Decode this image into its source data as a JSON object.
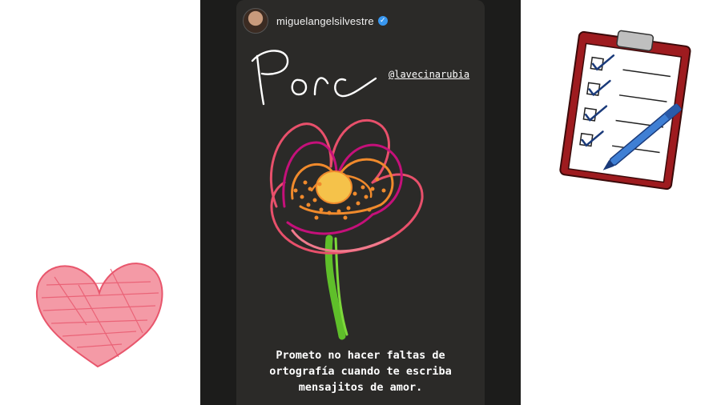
{
  "story": {
    "username": "miguelangelsilvestre",
    "verified_icon": "verified-badge-icon",
    "handwritten_word": "Porc",
    "mention": "@lavecinarubia",
    "caption_lines": [
      "Prometo no hacer faltas de",
      "ortografía cuando te escriba",
      "mensajitos de amor."
    ],
    "drawing": "flower-drawing",
    "colors": {
      "petal_outer": "#e8506b",
      "petal_inner": "#c5107a",
      "petal_orange": "#f08a2c",
      "center": "#f5c24a",
      "stem": "#5fbf2a",
      "background": "#2b2a28"
    }
  },
  "decorations": {
    "left": "heart-doodle",
    "right": "clipboard-checklist",
    "heart_color": "#f07a8c",
    "clipboard_color": "#9e1b1f",
    "pen_color": "#3f7fd4"
  }
}
